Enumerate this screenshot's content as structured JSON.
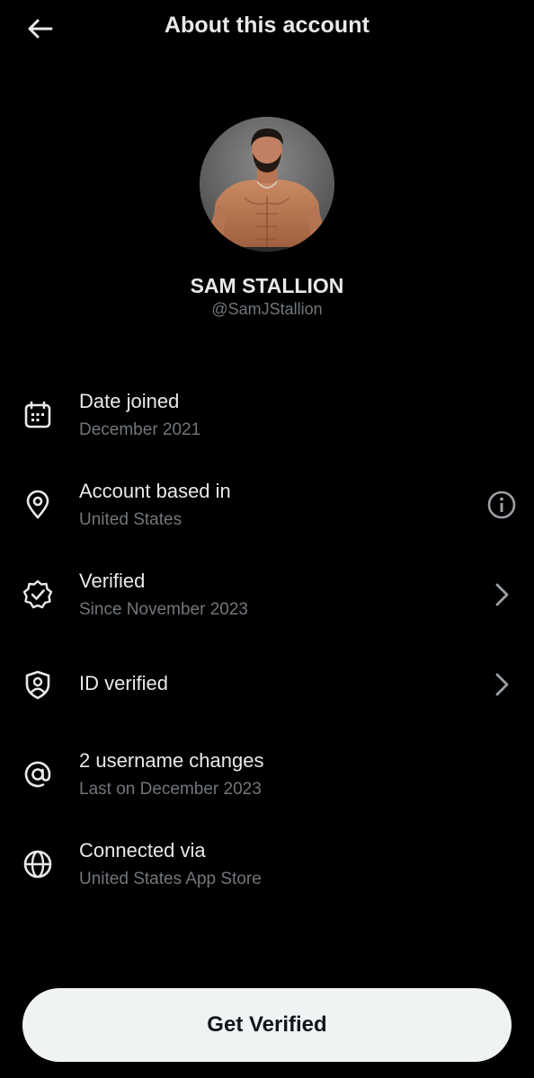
{
  "header": {
    "title": "About this account",
    "back_icon": "arrow-left-icon"
  },
  "profile": {
    "name": "SAM STALLION",
    "handle": "@SamJStallion"
  },
  "rows": [
    {
      "icon": "calendar-icon",
      "label": "Date joined",
      "sub": "December 2021",
      "trailing": ""
    },
    {
      "icon": "location-pin-icon",
      "label": "Account based in",
      "sub": "United States",
      "trailing": "info-icon"
    },
    {
      "icon": "verified-badge-icon",
      "label": "Verified",
      "sub": "Since November 2023",
      "trailing": "chevron-right-icon"
    },
    {
      "icon": "id-shield-icon",
      "label": "ID verified",
      "sub": "",
      "trailing": "chevron-right-icon"
    },
    {
      "icon": "at-sign-icon",
      "label": "2 username changes",
      "sub": "Last on December 2023",
      "trailing": ""
    },
    {
      "icon": "globe-icon",
      "label": "Connected via",
      "sub": "United States App Store",
      "trailing": ""
    }
  ],
  "cta": {
    "label": "Get Verified"
  },
  "colors": {
    "background": "#000000",
    "primary_text": "#e7e9ea",
    "secondary_text": "#71767b",
    "button_bg": "#eff3f4",
    "button_text": "#0f1419"
  }
}
